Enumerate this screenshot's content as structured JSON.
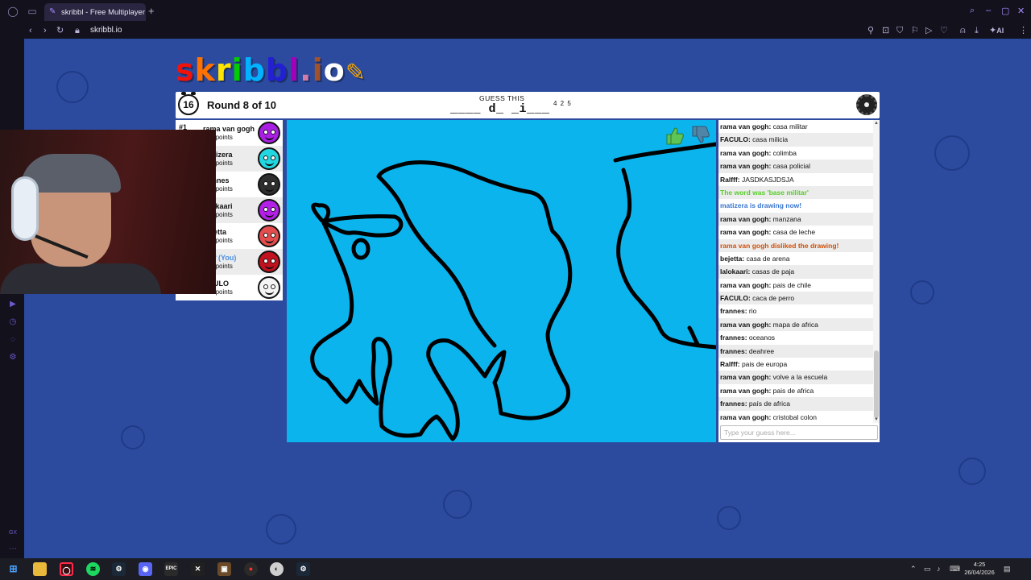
{
  "browser": {
    "tab_title": "skribbl - Free Multiplayer D",
    "url": "skribbl.io",
    "ai_label": "AI"
  },
  "game": {
    "logo": "skribbl.io",
    "timer": "16",
    "round": "Round 8 of 10",
    "guess_label": "GUESS THIS",
    "word_hint": "____ d_ _i___",
    "word_lengths": "4 2 5"
  },
  "players": [
    {
      "rank": "#1",
      "name": "rama van gogh",
      "points": "130 points",
      "you": false,
      "color": "#a81fe3"
    },
    {
      "rank": "",
      "name": "matizera",
      "points": "015 points",
      "you": false,
      "color": "#22d7e0"
    },
    {
      "rank": "",
      "name": "frannes",
      "points": "900 points",
      "you": false,
      "color": "#2e2e2e"
    },
    {
      "rank": "",
      "name": "lalokaari",
      "points": "740 points",
      "you": false,
      "color": "#b21fe6"
    },
    {
      "rank": "",
      "name": "bejetta",
      "points": "265 points",
      "you": false,
      "color": "#e34d4d"
    },
    {
      "rank": "",
      "name": "alfff (You)",
      "points": "640 points",
      "you": true,
      "color": "#c1121f"
    },
    {
      "rank": "",
      "name": "ACULO",
      "points": "150 points",
      "you": false,
      "color": "#f4f4f4"
    }
  ],
  "chat": {
    "messages": [
      {
        "author": "rama van gogh",
        "text": "casa militar",
        "type": "normal"
      },
      {
        "author": "FACULO",
        "text": "casa milicia",
        "type": "normal"
      },
      {
        "author": "rama van gogh",
        "text": "colimba",
        "type": "normal"
      },
      {
        "author": "rama van gogh",
        "text": "casa policial",
        "type": "normal"
      },
      {
        "author": "Ralfff",
        "text": "JASDKASJDSJA",
        "type": "normal"
      },
      {
        "author": "",
        "text": "The word was 'base militar'",
        "type": "green"
      },
      {
        "author": "",
        "text": "matizera is drawing now!",
        "type": "blue"
      },
      {
        "author": "rama van gogh",
        "text": "manzana",
        "type": "normal"
      },
      {
        "author": "rama van gogh",
        "text": "casa de leche",
        "type": "normal"
      },
      {
        "author": "",
        "text": "rama van gogh disliked the drawing!",
        "type": "orange"
      },
      {
        "author": "bejetta",
        "text": "casa de arena",
        "type": "normal"
      },
      {
        "author": "lalokaari",
        "text": "casas de paja",
        "type": "normal"
      },
      {
        "author": "rama van gogh",
        "text": "pais de chile",
        "type": "normal"
      },
      {
        "author": "FACULO",
        "text": "caca de perro",
        "type": "normal"
      },
      {
        "author": "frannes",
        "text": "rio",
        "type": "normal"
      },
      {
        "author": "rama van gogh",
        "text": "mapa de africa",
        "type": "normal"
      },
      {
        "author": "frannes",
        "text": "oceanos",
        "type": "normal"
      },
      {
        "author": "frannes",
        "text": "deahree",
        "type": "normal"
      },
      {
        "author": "Ralfff",
        "text": "pais de europa",
        "type": "normal"
      },
      {
        "author": "rama van gogh",
        "text": "volve a la escuela",
        "type": "normal"
      },
      {
        "author": "rama van gogh",
        "text": "pais de africa",
        "type": "normal"
      },
      {
        "author": "frannes",
        "text": "país de africa",
        "type": "normal"
      },
      {
        "author": "rama van gogh",
        "text": "cristobal colon",
        "type": "normal"
      }
    ],
    "input_placeholder": "Type your guess here..."
  },
  "taskbar": {
    "time": "4:25",
    "date": "26/04/2026"
  },
  "colors": {
    "page_bg": "#2c4b9f",
    "canvas_bg": "#0cb4ee",
    "chat_green": "#56ce27",
    "chat_blue": "#3975ce",
    "chat_orange": "#ce4f0a"
  }
}
